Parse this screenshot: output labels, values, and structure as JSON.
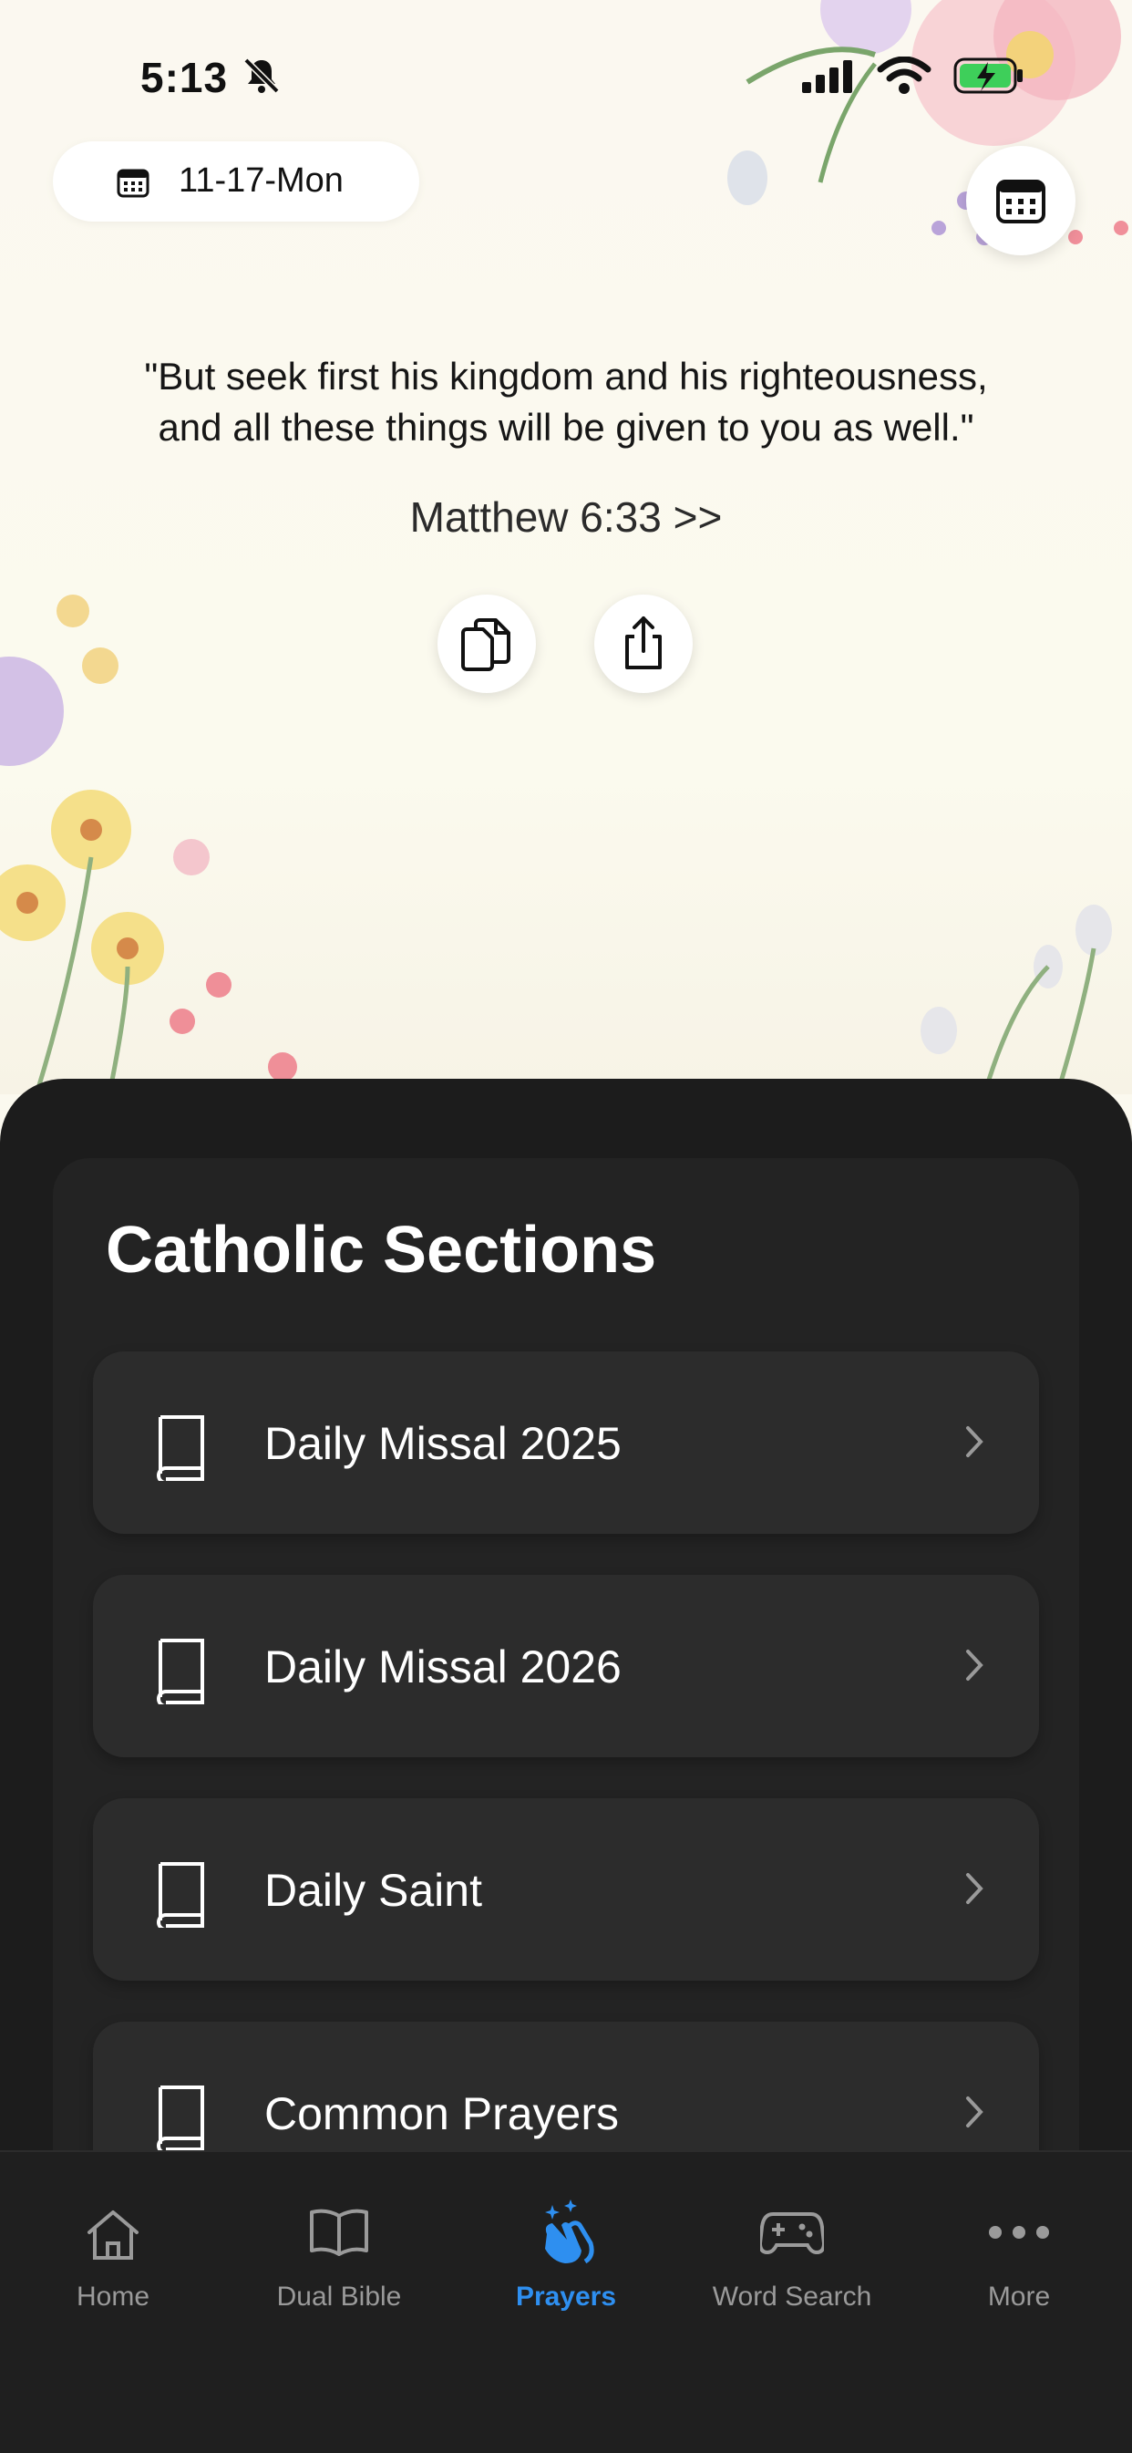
{
  "status_bar": {
    "time": "5:13"
  },
  "header": {
    "date": "11-17-Mon"
  },
  "verse": {
    "line1": "\"But seek first his kingdom and his righteousness,",
    "line2": "and all these things will be given to you as well.\"",
    "reference": "Matthew 6:33 >>"
  },
  "catholic_sections": {
    "title": "Catholic Sections",
    "items": [
      {
        "label": "Daily Missal 2025"
      },
      {
        "label": "Daily Missal 2026"
      },
      {
        "label": "Daily Saint"
      },
      {
        "label": "Common Prayers"
      }
    ]
  },
  "tabbar": {
    "tabs": [
      {
        "label": "Home",
        "icon": "home-icon"
      },
      {
        "label": "Dual Bible",
        "icon": "open-book-icon"
      },
      {
        "label": "Prayers",
        "icon": "praying-hands-icon"
      },
      {
        "label": "Word Search",
        "icon": "gamepad-icon"
      },
      {
        "label": "More",
        "icon": "ellipsis-icon"
      }
    ],
    "active_color": "#2e8ff0",
    "inactive_color": "#9a9a9a"
  }
}
